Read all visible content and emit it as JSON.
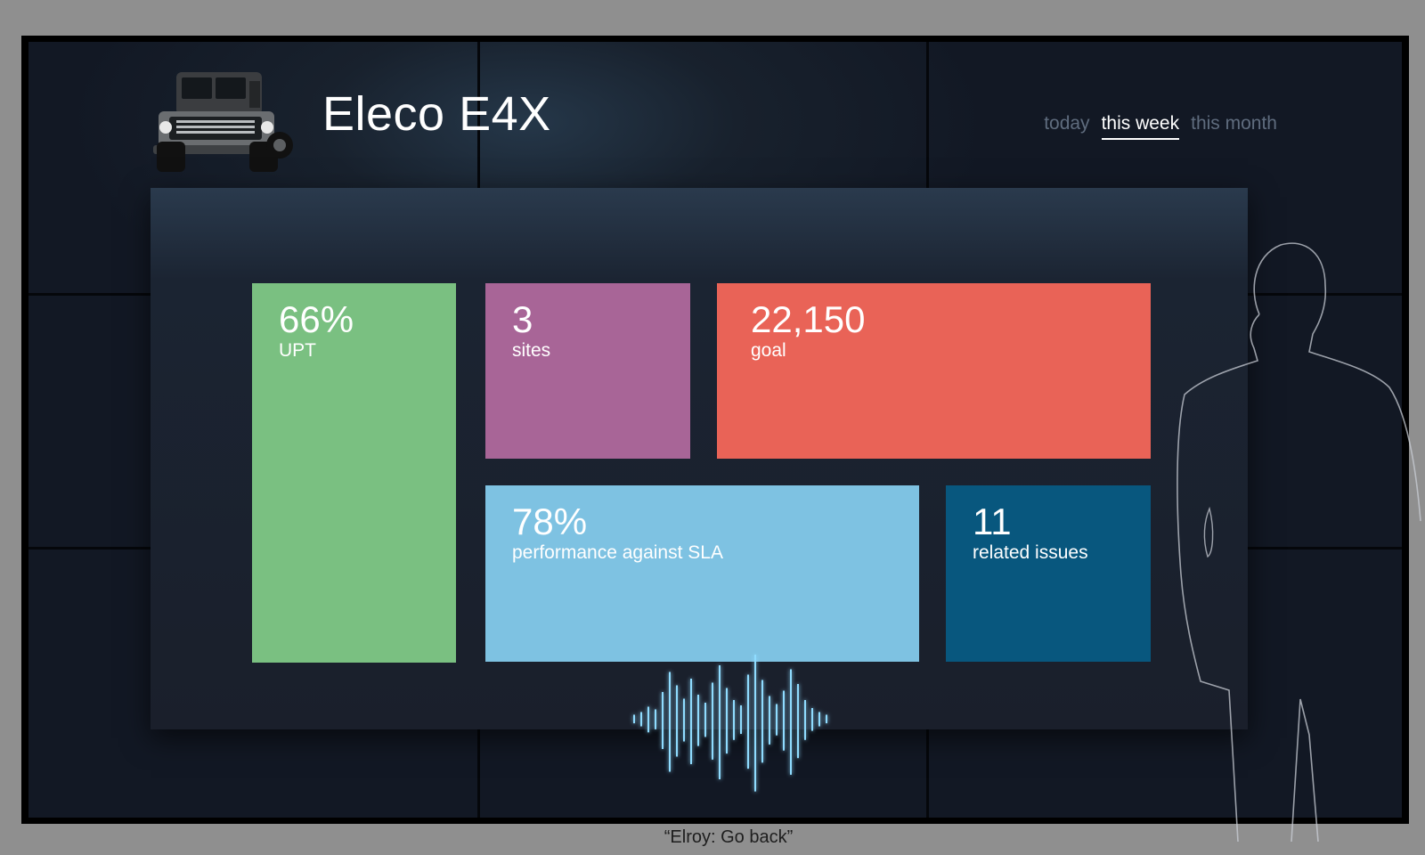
{
  "header": {
    "title": "Eleco E4X",
    "vehicle_image": "suv-icon",
    "time_tabs": [
      {
        "label": "today",
        "active": false
      },
      {
        "label": "this week",
        "active": true
      },
      {
        "label": "this month",
        "active": false
      }
    ]
  },
  "tiles": {
    "upt": {
      "value": "66%",
      "label": "UPT",
      "color": "#7ac081"
    },
    "sites": {
      "value": "3",
      "label": "sites",
      "color": "#a86597"
    },
    "goal": {
      "value": "22,150",
      "label": "goal",
      "color": "#e96357"
    },
    "sla": {
      "value": "78%",
      "label": "performance against SLA",
      "color": "#7ec2e2"
    },
    "issues": {
      "value": "11",
      "label": "related issues",
      "color": "#08577e"
    }
  },
  "caption": "“Elroy: Go back”"
}
